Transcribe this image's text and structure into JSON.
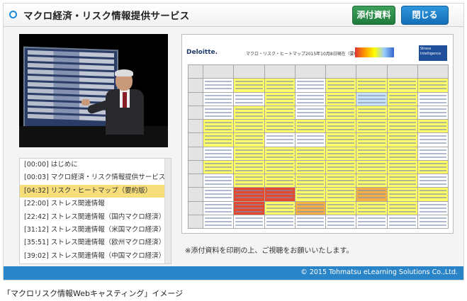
{
  "header": {
    "title": "マクロ経済・リスク情報提供サービス"
  },
  "toolbar": {
    "attachment_label": "添付資料",
    "close_label": "閉じる"
  },
  "chapters": [
    {
      "time": "[00:00]",
      "label": "はじめに",
      "active": false
    },
    {
      "time": "[00:03]",
      "label": "マクロ経済・リスク情報提供サービス",
      "active": false
    },
    {
      "time": "[04:32]",
      "label": "リスク・ヒートマップ（要約版）",
      "active": true
    },
    {
      "time": "[22:00]",
      "label": "ストレス関連情報",
      "active": false
    },
    {
      "time": "[22:42]",
      "label": "ストレス関連情報（国内マクロ経済）",
      "active": false
    },
    {
      "time": "[31:12]",
      "label": "ストレス関連情報（米国マクロ経済）",
      "active": false
    },
    {
      "time": "[35:51]",
      "label": "ストレス関連情報（欧州マクロ経済）",
      "active": false
    },
    {
      "time": "[39:02]",
      "label": "ストレス関連情報（中国マクロ経済）",
      "active": false
    }
  ],
  "document": {
    "logo": "Deloitte.",
    "title": "マクロ・リスク・ヒートマップ2015年10月8日現在（要約版）",
    "badge": "Stress Intelligence"
  },
  "note": "※添付資料を印刷の上、ご視聴をお願いいたします。",
  "footer": {
    "copyright": "© 2015 Tohmatsu eLearning Solutions Co.,Ltd."
  },
  "caption": "「マクロリスク情報Webキャスティング」イメージ",
  "colors": {
    "accent_blue": "#2a84c8",
    "attach_green": "#2e8b4a",
    "highlight": "#f6de7a"
  }
}
